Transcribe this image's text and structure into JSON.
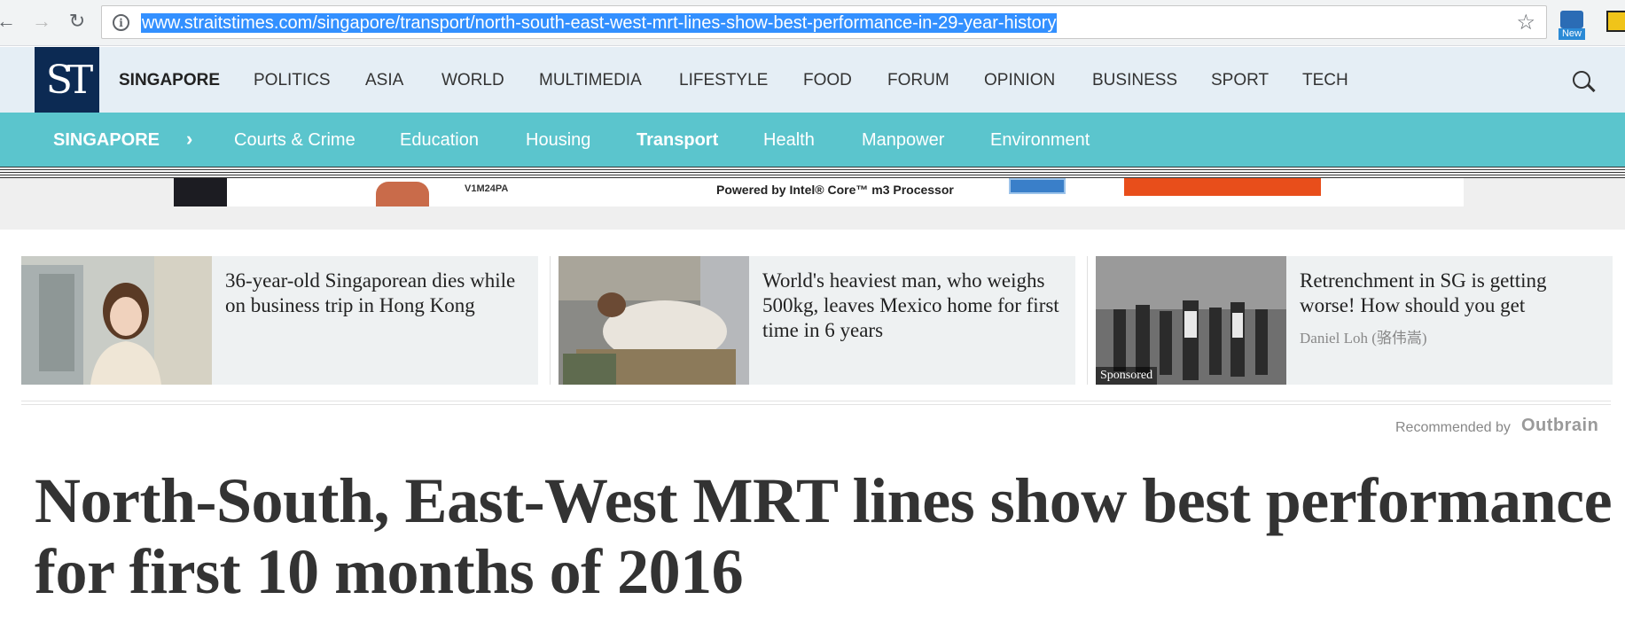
{
  "browser": {
    "url": "www.straitstimes.com/singapore/transport/north-south-east-west-mrt-lines-show-best-performance-in-29-year-history",
    "ext_badge": "New"
  },
  "site": {
    "logo": "ST",
    "top_nav": [
      "SINGAPORE",
      "POLITICS",
      "ASIA",
      "WORLD",
      "MULTIMEDIA",
      "LIFESTYLE",
      "FOOD",
      "FORUM",
      "OPINION",
      "BUSINESS",
      "SPORT",
      "TECH"
    ],
    "section": "SINGAPORE",
    "sub_nav": [
      "Courts & Crime",
      "Education",
      "Housing",
      "Transport",
      "Health",
      "Manpower",
      "Environment"
    ],
    "active_sub": "Transport"
  },
  "ad": {
    "code": "V1M24PA",
    "text": "Powered by Intel® Core™ m3 Processor"
  },
  "recommendations": [
    {
      "title": "36-year-old Singaporean dies while on business trip in Hong Kong",
      "source": ""
    },
    {
      "title": "World's heaviest man, who weighs 500kg, leaves Mexico home for first time in 6 years",
      "source": ""
    },
    {
      "title": "Retrenchment in SG is getting worse! How should you get",
      "source": "Daniel Loh (骆伟嵩)",
      "badge": "Sponsored"
    }
  ],
  "recommended_by": "Recommended by",
  "outbrain": "Outbrain",
  "headline": "North-South, East-West MRT lines show best performance for first 10 months of 2016",
  "colors": {
    "navy": "#0c2a53",
    "teal": "#5bc5cd",
    "nav_bg": "#e5eef5"
  },
  "icons": [
    "back-arrow-icon",
    "forward-arrow-icon",
    "reload-icon",
    "info-icon",
    "star-icon",
    "search-icon",
    "chevron-right-icon"
  ]
}
